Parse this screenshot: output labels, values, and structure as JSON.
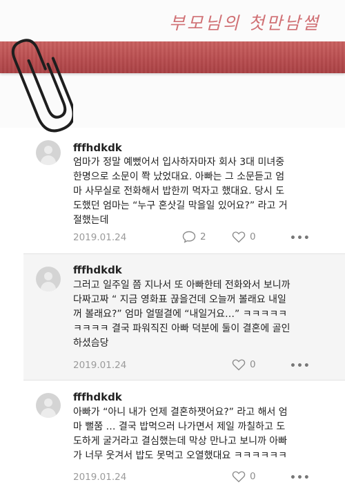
{
  "header": {
    "title": "부모님의 첫만남썰"
  },
  "posts": [
    {
      "username": "fffhdkdk",
      "text": "엄마가 정말 예뻤어서 입사하자마자 회사 3대 미녀중\n한명으로 소문이 쫙 났었대요. 아빠는 그 소문듣고 엄\n마 사무실로 전화해서 밥한끼 먹자고 했대요. 당시 도\n도했던 엄마는 “누구 혼삿길 막을일 있어요?” 라고 거\n절했는데",
      "date": "2019.01.24",
      "comment_count": "2",
      "like_count": "0",
      "more": "•••"
    },
    {
      "username": "fffhdkdk",
      "text": "그러고 일주일 쯤 지나서 또 아빠한테 전화와서 보니까\n다짜고짜 “ 지금 영화표 끊을건데 오늘꺼 볼래요 내일\n꺼 볼래요?” 엄마 얼떨결에 “내일거요…” ㅋㅋㅋㅋㅋ\nㅋㅋㅋㅋ 결국 파워직진 아빠 덕분에 둘이 결혼에 골인\n하셨슴당",
      "date": "2019.01.24",
      "like_count": "0",
      "more": "•••"
    },
    {
      "username": "fffhdkdk",
      "text": "아빠가 “아니 내가 언제 결혼하잿어요?” 라고 해서 엄\n마 뻘쭘 … 결국 밥먹으러 나가면서 제일 까칠하고 도\n도하게 굴거라고 결심했는데 막상 만나고 보니까 아빠\n가 너무 웃겨서 밥도 못먹고 오열했대요 ㅋㅋㅋㅋㅋㅋ",
      "date": "2019.01.24",
      "like_count": "0",
      "more": "•••"
    }
  ]
}
